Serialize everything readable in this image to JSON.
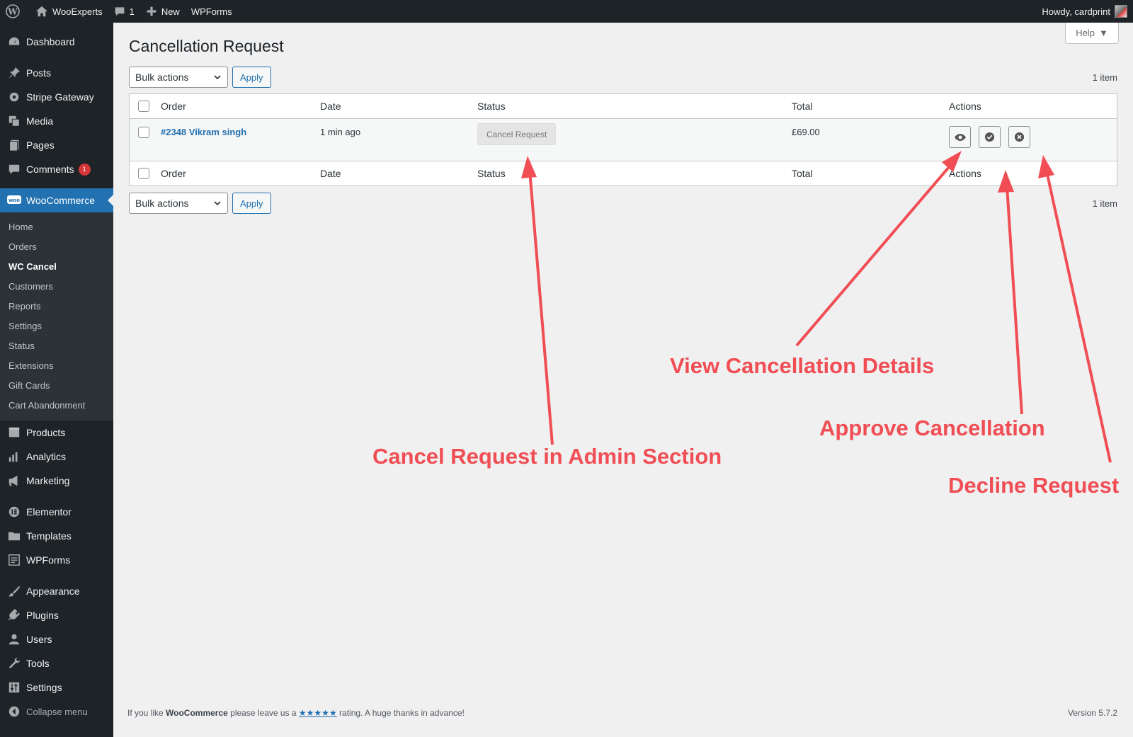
{
  "adminbar": {
    "site_name": "WooExperts",
    "comments_count": "1",
    "new_label": "New",
    "wpforms_label": "WPForms",
    "howdy": "Howdy, cardprint"
  },
  "sidebar": {
    "dashboard": "Dashboard",
    "posts": "Posts",
    "stripe": "Stripe Gateway",
    "media": "Media",
    "pages": "Pages",
    "comments": "Comments",
    "comments_badge": "1",
    "woocommerce": "WooCommerce",
    "woo_sub": [
      "Home",
      "Orders",
      "WC Cancel",
      "Customers",
      "Reports",
      "Settings",
      "Status",
      "Extensions",
      "Gift Cards",
      "Cart Abandonment"
    ],
    "products": "Products",
    "analytics": "Analytics",
    "marketing": "Marketing",
    "elementor": "Elementor",
    "templates": "Templates",
    "wpforms": "WPForms",
    "appearance": "Appearance",
    "plugins": "Plugins",
    "users": "Users",
    "tools": "Tools",
    "settings": "Settings",
    "collapse": "Collapse menu"
  },
  "help_label": "Help",
  "page_title": "Cancellation Request",
  "tablenav": {
    "bulk_actions": "Bulk actions",
    "apply": "Apply",
    "count": "1 item"
  },
  "table": {
    "headers": {
      "order": "Order",
      "date": "Date",
      "status": "Status",
      "total": "Total",
      "actions": "Actions"
    },
    "rows": [
      {
        "order": "#2348 Vikram singh",
        "date": "1 min ago",
        "status": "Cancel Request",
        "total": "£69.00"
      }
    ]
  },
  "footer": {
    "text_pre": "If you like ",
    "brand": "WooCommerce",
    "text_mid": " please leave us a ",
    "stars": "★★★★★",
    "text_post": " rating. A huge thanks in advance!",
    "version": "Version 5.7.2"
  },
  "annotations": {
    "view": "View Cancellation Details",
    "approve": "Approve Cancellation",
    "decline": "Decline Request",
    "cancel_req": "Cancel Request in Admin Section",
    "color": "#f04e54"
  }
}
